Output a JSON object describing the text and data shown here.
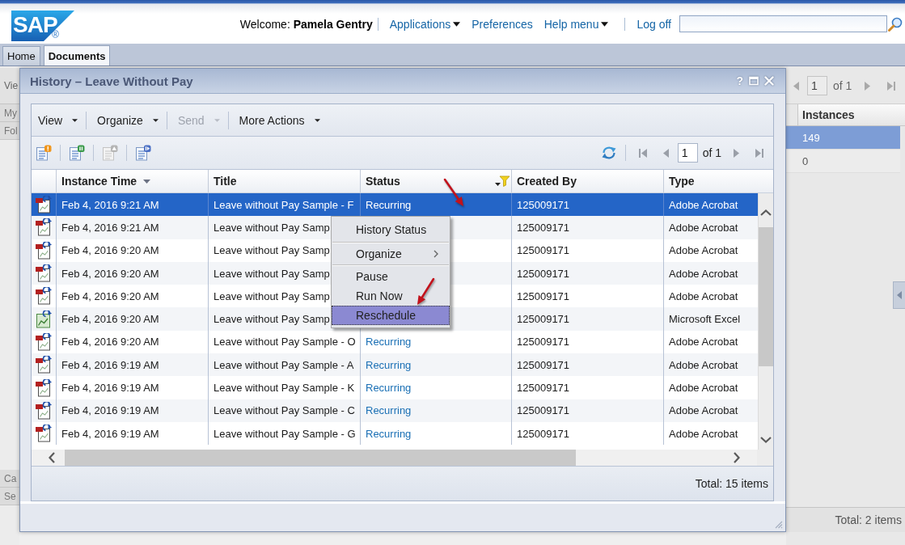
{
  "header": {
    "logo": {
      "text": "SAP",
      "mark": "®"
    },
    "welcome": "Welcome: **Pamela Gentry**",
    "link_groups": [
      [
        {
          "label": "Applications",
          "dropdown": true
        },
        {
          "label": "Preferences",
          "dropdown": false
        },
        {
          "label": "Help menu",
          "dropdown": true
        }
      ],
      [
        {
          "label": "Log off",
          "dropdown": false
        }
      ]
    ]
  },
  "tabs": [
    {
      "label": "Home",
      "selected": false
    },
    {
      "label": "Documents",
      "selected": true
    }
  ],
  "background": {
    "left_panel": {
      "toolbar_label": "Vie",
      "items_top": [
        "My",
        "Fol"
      ],
      "items_bottom": [
        "Ca",
        "Se"
      ]
    },
    "right_panel": {
      "pager": {
        "page": "1",
        "page_count": "of 1"
      },
      "column": "Instances",
      "rows": [
        {
          "value": "149",
          "selected": true
        },
        {
          "value": "0",
          "selected": false
        }
      ],
      "status": "Total: 2 items"
    }
  },
  "dialog": {
    "title": "History – Leave Without Pay",
    "help_label": "?",
    "menu": [
      {
        "label": "View",
        "disabled": false
      },
      {
        "label": "Organize",
        "disabled": false
      },
      {
        "label": "Send",
        "disabled": true
      },
      {
        "label": "More Actions",
        "disabled": false
      }
    ],
    "toolbar": {
      "actions": [
        {
          "kind": "alert",
          "disabled": false
        },
        {
          "kind": "pause",
          "disabled": false
        },
        {
          "kind": "up",
          "disabled": true
        },
        {
          "kind": "play",
          "disabled": false
        }
      ],
      "page": "1",
      "page_count": "of 1"
    },
    "table": {
      "columns": [
        {
          "label": "Instance Time",
          "sorted_descending": true,
          "filter": false
        },
        {
          "label": "Title",
          "sorted_descending": false,
          "filter": false
        },
        {
          "label": "Status",
          "sorted_descending": false,
          "filter": true
        },
        {
          "label": "Created By",
          "sorted_descending": false,
          "filter": false
        },
        {
          "label": "Type",
          "sorted_descending": false,
          "filter": false
        }
      ],
      "rows": [
        {
          "kind": "pdf",
          "selected": true,
          "instance_time": "Feb 4, 2016 9:21 AM",
          "title": "Leave without Pay Sample - F",
          "status": "Recurring",
          "created_by": "125009171",
          "type": "Adobe Acrobat"
        },
        {
          "kind": "pdf",
          "selected": false,
          "instance_time": "Feb 4, 2016 9:21 AM",
          "title": "Leave without Pay Samp",
          "created_by": "125009171",
          "type": "Adobe Acrobat"
        },
        {
          "kind": "pdf",
          "selected": false,
          "instance_time": "Feb 4, 2016 9:20 AM",
          "title": "Leave without Pay Samp",
          "created_by": "125009171",
          "type": "Adobe Acrobat"
        },
        {
          "kind": "pdf",
          "selected": false,
          "instance_time": "Feb 4, 2016 9:20 AM",
          "title": "Leave without Pay Samp",
          "created_by": "125009171",
          "type": "Adobe Acrobat"
        },
        {
          "kind": "pdf",
          "selected": false,
          "instance_time": "Feb 4, 2016 9:20 AM",
          "title": "Leave without Pay Samp",
          "created_by": "125009171",
          "type": "Adobe Acrobat"
        },
        {
          "kind": "xls",
          "selected": false,
          "instance_time": "Feb 4, 2016 9:20 AM",
          "title": "Leave without Pay Samp",
          "created_by": "125009171",
          "type": "Microsoft Excel"
        },
        {
          "kind": "pdf",
          "selected": false,
          "instance_time": "Feb 4, 2016 9:20 AM",
          "title": "Leave without Pay Sample - O",
          "status": "Recurring",
          "created_by": "125009171",
          "type": "Adobe Acrobat"
        },
        {
          "kind": "pdf",
          "selected": false,
          "instance_time": "Feb 4, 2016 9:19 AM",
          "title": "Leave without Pay Sample - A",
          "status": "Recurring",
          "created_by": "125009171",
          "type": "Adobe Acrobat"
        },
        {
          "kind": "pdf",
          "selected": false,
          "instance_time": "Feb 4, 2016 9:19 AM",
          "title": "Leave without Pay Sample - K",
          "status": "Recurring",
          "created_by": "125009171",
          "type": "Adobe Acrobat"
        },
        {
          "kind": "pdf",
          "selected": false,
          "instance_time": "Feb 4, 2016 9:19 AM",
          "title": "Leave without Pay Sample - C",
          "status": "Recurring",
          "created_by": "125009171",
          "type": "Adobe Acrobat"
        },
        {
          "kind": "pdf",
          "selected": false,
          "instance_time": "Feb 4, 2016 9:19 AM",
          "title": "Leave without Pay Sample - G",
          "status": "Recurring",
          "created_by": "125009171",
          "type": "Adobe Acrobat"
        }
      ]
    },
    "footer": "Total: 15 items",
    "context_menu": {
      "groups": [
        [
          {
            "label": "History Status",
            "submenu": false,
            "selected": false
          }
        ],
        [
          {
            "label": "Organize",
            "submenu": true,
            "selected": false
          }
        ],
        [
          {
            "label": "Pause",
            "submenu": false,
            "selected": false
          },
          {
            "label": "Run Now",
            "submenu": false,
            "selected": false
          },
          {
            "label": "Reschedule",
            "submenu": false,
            "selected": true
          }
        ]
      ]
    }
  }
}
